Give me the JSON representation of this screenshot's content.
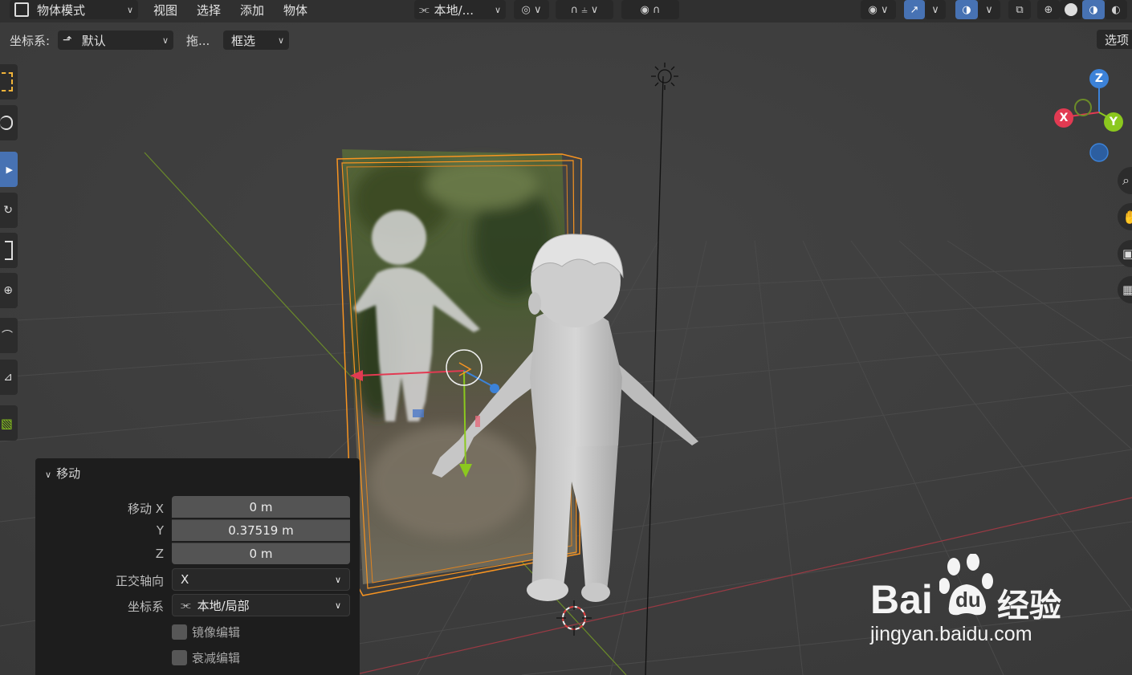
{
  "header": {
    "mode": "物体模式",
    "menus": [
      "视图",
      "选择",
      "添加",
      "物体"
    ],
    "transform_orientation": "本地/...",
    "icons": [
      "pivot-icon",
      "snap-icon",
      "proportional-edit-icon",
      "visibility-icon",
      "gizmo-icon",
      "overlay-icon",
      "xray-icon",
      "shading-wireframe-icon",
      "shading-solid-icon",
      "shading-material-icon",
      "shading-rendered-icon"
    ]
  },
  "tool_settings": {
    "coord_label": "坐标系:",
    "coord_value": "默认",
    "drag_label": "拖...",
    "drag_value": "框选",
    "options_label": "选项"
  },
  "gizmo": {
    "z": "Z",
    "x": "X",
    "y": "Y"
  },
  "operator_panel": {
    "title": "移动",
    "move_x_label": "移动 X",
    "y_label": "Y",
    "z_label": "Z",
    "move_x": "0 m",
    "move_y": "0.37519 m",
    "move_z": "0 m",
    "ortho_axis_label": "正交轴向",
    "ortho_axis_value": "X",
    "coord_label": "坐标系",
    "coord_value": "本地/局部",
    "mirror_label": "镜像编辑",
    "proportional_label": "衰减编辑"
  },
  "watermark": {
    "bai": "Bai",
    "du": "du",
    "jingyan": "经验",
    "url": "jingyan.baidu.com"
  },
  "colors": {
    "accent": "#4772b3",
    "x_axis": "#e23a52",
    "y_axis": "#8bc81e",
    "z_axis": "#3c82d8",
    "selection": "#f79421"
  }
}
